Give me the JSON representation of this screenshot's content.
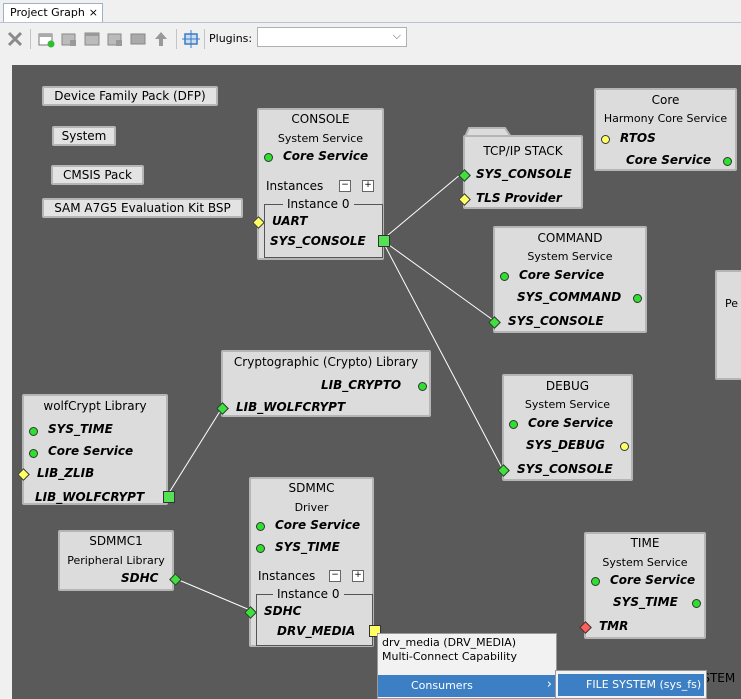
{
  "tab": {
    "label": "Project Graph",
    "close": "×"
  },
  "toolbar": {
    "plugins_label": "Plugins:",
    "plugins_value": "",
    "plugins_arrow": "⌵"
  },
  "buttons": {
    "dfp": "Device Family Pack (DFP)",
    "system": "System",
    "cmsis": "CMSIS Pack",
    "bsp": "SAM A7G5 Evaluation Kit BSP"
  },
  "console": {
    "title": "CONSOLE",
    "subtitle": "System Service",
    "core": "Core Service",
    "instances_label": "Instances",
    "instance0": "Instance 0",
    "uart": "UART",
    "sys_console": "SYS_CONSOLE"
  },
  "tcpip": {
    "title": "TCP/IP STACK",
    "sys_console": "SYS_CONSOLE",
    "tls": "TLS Provider"
  },
  "core": {
    "title": "Core",
    "subtitle": "Harmony Core Service",
    "rtos": "RTOS",
    "core_service": "Core Service"
  },
  "command": {
    "title": "COMMAND",
    "subtitle": "System Service",
    "core": "Core Service",
    "sys_command": "SYS_COMMAND",
    "sys_console": "SYS_CONSOLE"
  },
  "partial_right": {
    "text": "Pe"
  },
  "crypto": {
    "title": "Cryptographic (Crypto) Library",
    "lib_crypto": "LIB_CRYPTO",
    "lib_wolfcrypt": "LIB_WOLFCRYPT"
  },
  "wolfcrypt": {
    "title": "wolfCrypt Library",
    "sys_time": "SYS_TIME",
    "core": "Core Service",
    "lib_zlib": "LIB_ZLIB",
    "lib_wolfcrypt": "LIB_WOLFCRYPT"
  },
  "debug": {
    "title": "DEBUG",
    "subtitle": "System Service",
    "core": "Core Service",
    "sys_debug": "SYS_DEBUG",
    "sys_console": "SYS_CONSOLE"
  },
  "sdmmc": {
    "title": "SDMMC",
    "subtitle": "Driver",
    "core": "Core Service",
    "sys_time": "SYS_TIME",
    "instances_label": "Instances",
    "instance0": "Instance 0",
    "sdhc": "SDHC",
    "drv_media": "DRV_MEDIA"
  },
  "sdmmc1": {
    "title": "SDMMC1",
    "subtitle": "Peripheral Library",
    "sdhc": "SDHC"
  },
  "time": {
    "title": "TIME",
    "subtitle": "System Service",
    "core": "Core Service",
    "sys_time": "SYS_TIME",
    "tmr": "TMR"
  },
  "popup": {
    "line1": "drv_media (DRV_MEDIA)",
    "line2": "Multi-Connect Capability",
    "consumers": "Consumers",
    "arrow": "›"
  },
  "submenu": {
    "item": "FILE SYSTEM (sys_fs)",
    "cut_text": "YSTEM"
  }
}
